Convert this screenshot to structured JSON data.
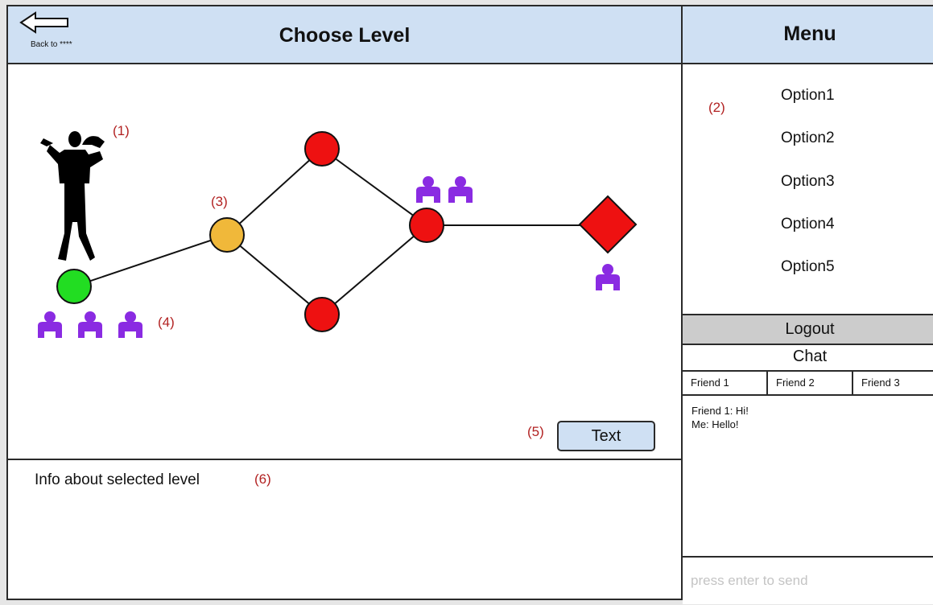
{
  "header": {
    "title": "Choose Level",
    "back_label": "Back to ****"
  },
  "annotations": {
    "n1": "(1)",
    "n2": "(2)",
    "n3": "(3)",
    "n4": "(4)",
    "n5": "(5)",
    "n6": "(6)"
  },
  "map": {
    "colors": {
      "completed": "#22dd22",
      "current": "#f0b83a",
      "locked": "#ee1111",
      "boss": "#ee1111",
      "friend": "#8a2be2"
    }
  },
  "text_button": {
    "label": "Text"
  },
  "info": {
    "text": "Info about selected level"
  },
  "menu": {
    "title": "Menu",
    "options": [
      "Option1",
      "Option2",
      "Option3",
      "Option4",
      "Option5"
    ],
    "logout": "Logout"
  },
  "chat": {
    "title": "Chat",
    "tabs": [
      "Friend 1",
      "Friend 2",
      "Friend 3"
    ],
    "messages": [
      "Friend 1: Hi!",
      "Me: Hello!"
    ],
    "input_placeholder": "press enter to send"
  }
}
